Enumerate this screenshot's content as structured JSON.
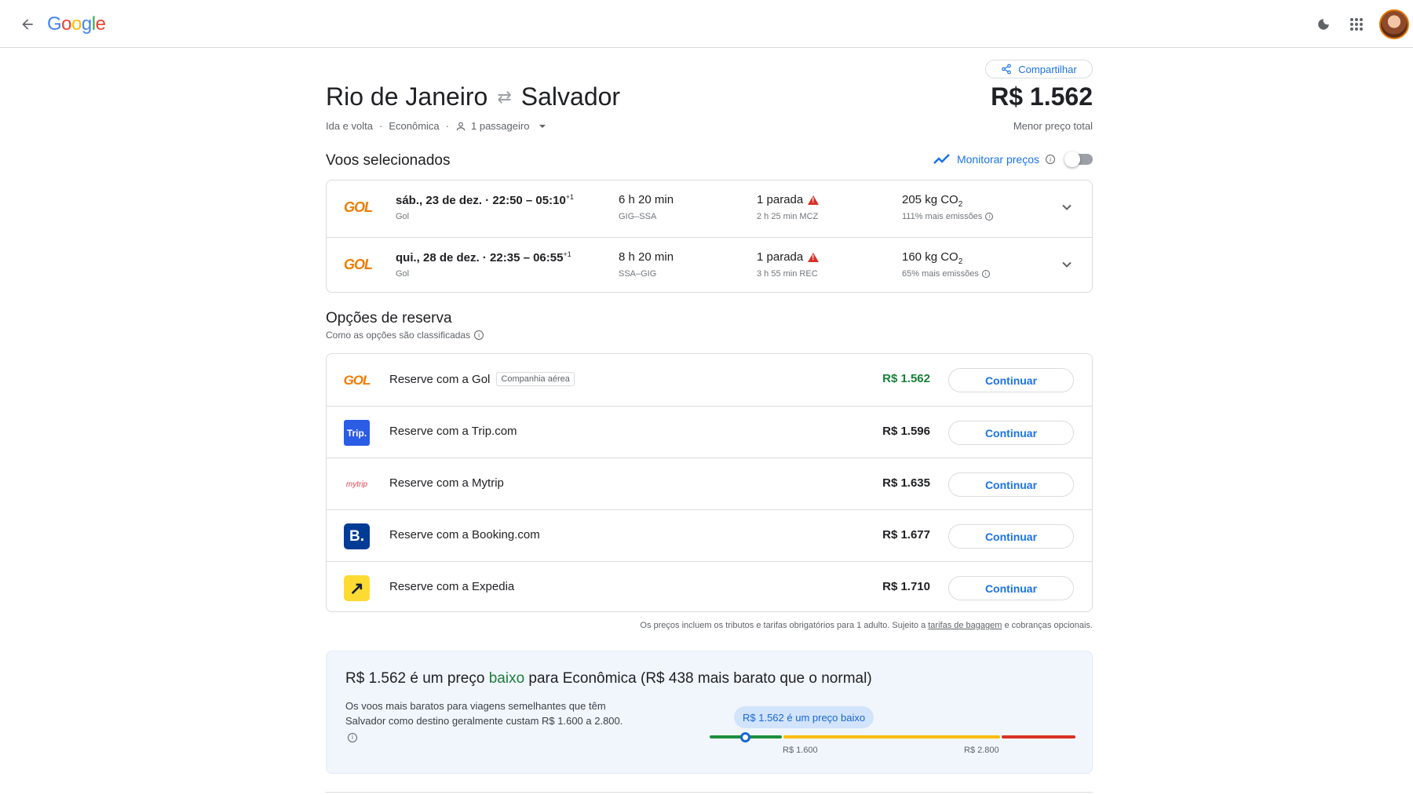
{
  "header": {
    "logo": [
      "G",
      "o",
      "o",
      "g",
      "l",
      "e"
    ],
    "logo_colors": [
      "#4285F4",
      "#EA4335",
      "#FBBC05",
      "#4285F4",
      "#34A853",
      "#EA4335"
    ]
  },
  "share": {
    "label": "Compartilhar"
  },
  "route": {
    "origin": "Rio de Janeiro",
    "destination": "Salvador",
    "trip_type": "Ida e volta",
    "cabin": "Econômica",
    "passengers": "1 passageiro",
    "total_price": "R$ 1.562",
    "total_label": "Menor preço total"
  },
  "selected": {
    "title": "Voos selecionados",
    "monitor_label": "Monitorar preços",
    "flights": [
      {
        "airline_logo": "GOL",
        "date": "sáb., 23 de dez.",
        "times": "22:50 – 05:10",
        "day_offset": "+1",
        "airline": "Gol",
        "duration": "6 h 20 min",
        "route": "GIG–SSA",
        "stops": "1 parada",
        "layover": "2 h 25 min MCZ",
        "co2": "205 kg CO",
        "co2_sub": "2",
        "emissions": "111% mais emissões"
      },
      {
        "airline_logo": "GOL",
        "date": "qui., 28 de dez.",
        "times": "22:35 – 06:55",
        "day_offset": "+1",
        "airline": "Gol",
        "duration": "8 h 20 min",
        "route": "SSA–GIG",
        "stops": "1 parada",
        "layover": "3 h 55 min REC",
        "co2": "160 kg CO",
        "co2_sub": "2",
        "emissions": "65% mais emissões"
      }
    ]
  },
  "booking": {
    "title": "Opções de reserva",
    "subtitle": "Como as opções são classificadas",
    "continue_label": "Continuar",
    "airline_tag": "Companhia aérea",
    "options": [
      {
        "name": "Reserve com a Gol",
        "price": "R$ 1.562",
        "logo_text": "GOL"
      },
      {
        "name": "Reserve com a Trip.com",
        "price": "R$ 1.596",
        "logo_text": "Trip."
      },
      {
        "name": "Reserve com a Mytrip",
        "price": "R$ 1.635",
        "logo_text": "mytrip"
      },
      {
        "name": "Reserve com a Booking.com",
        "price": "R$ 1.677",
        "logo_text": "B."
      },
      {
        "name": "Reserve com a Expedia",
        "price": "R$ 1.710",
        "logo_text": "↗"
      }
    ]
  },
  "disclaimer": {
    "before": "Os preços incluem os tributos e tarifas obrigatórios para 1 adulto. Sujeito a ",
    "link": "tarifas de bagagem",
    "after": " e cobranças opcionais."
  },
  "insight": {
    "title_pre": "R$ 1.562 é um preço ",
    "title_low": "baixo",
    "title_post": " para Econômica (R$ 438 mais barato que o normal)",
    "description": "Os voos mais baratos para viagens semelhantes que têm Salvador como destino geralmente custam R$ 1.600 a 2.800.",
    "bubble": "R$ 1.562 é um preço baixo",
    "low_bound": "R$ 1.600",
    "high_bound": "R$ 2.800",
    "current_value": 1562,
    "range_colors": {
      "low": "#1e8e3e",
      "typical": "#fbbc04",
      "high": "#d93025"
    }
  }
}
